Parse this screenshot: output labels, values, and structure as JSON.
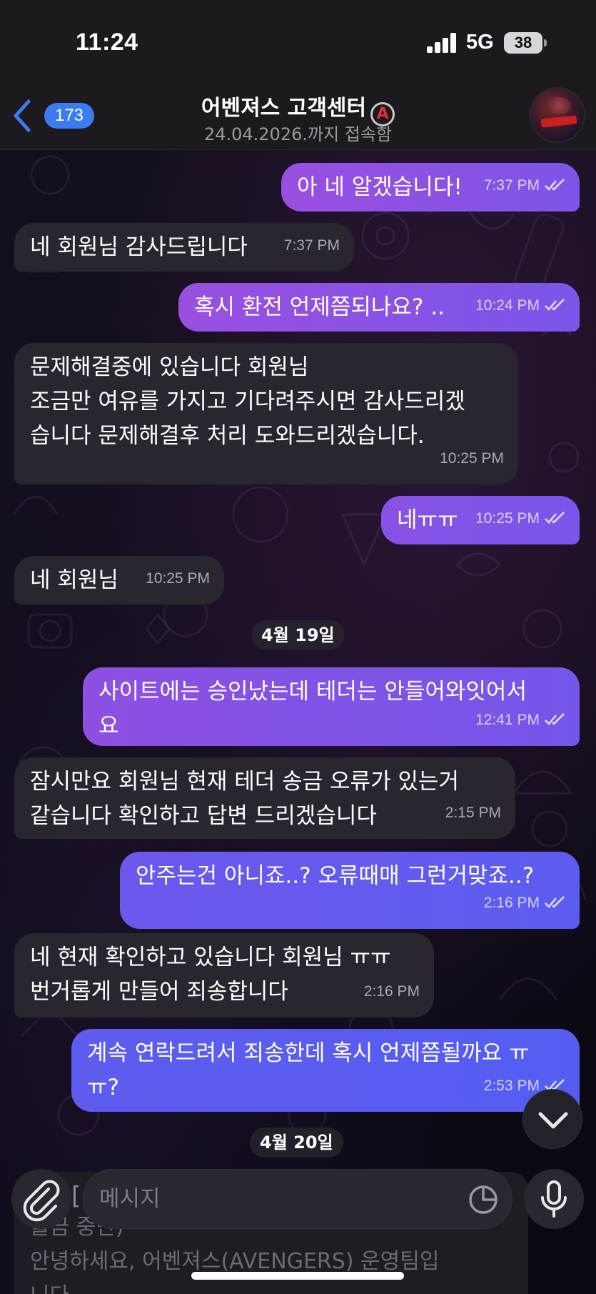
{
  "status_bar": {
    "time": "11:24",
    "network": "5G",
    "battery": "38"
  },
  "header": {
    "back_count": "173",
    "title": "어벤져스 고객센터",
    "title_icon": "avengers-logo-icon",
    "subtitle": "24.04.2026.까지 접속함",
    "avatar": "channel-avatar"
  },
  "messages": [
    {
      "dir": "out",
      "text": "아 네 알겠습니다!",
      "time": "7:37 PM",
      "read": true
    },
    {
      "dir": "in",
      "text": "네 회원님 감사드립니다",
      "time": "7:37 PM"
    },
    {
      "dir": "out",
      "text": "혹시 환전 언제쯤되나요? ..",
      "time": "10:24 PM",
      "read": true
    },
    {
      "dir": "in",
      "text": "문제해결중에 있습니다 회원님\n조금만 여유를 가지고 기다려주시면 감사드리겠\n습니다 문제해결후 처리 도와드리겠습니다.",
      "time": "10:25 PM"
    },
    {
      "dir": "out",
      "text": "네ㅠㅠ",
      "time": "10:25 PM",
      "read": true
    },
    {
      "dir": "in",
      "text": "네 회원님",
      "time": "10:25 PM"
    },
    {
      "dir": "out",
      "text": "사이트에는 승인났는데 테더는 안들어와잇어서\n요",
      "time": "12:41 PM",
      "read": true
    },
    {
      "dir": "in",
      "text": "잠시만요 회원님 현재 테더 송금 오류가 있는거\n같습니다 확인하고 답변 드리겠습니다",
      "time": "2:15 PM"
    },
    {
      "dir": "out",
      "text": "안주는건 아니죠..? 오류때매 그런거맞죠..?",
      "time": "2:16 PM",
      "read": true
    },
    {
      "dir": "in",
      "text": "네 현재 확인하고 있습니다 회원님 ㅠㅠ\n번거롭게 만들어 죄송합니다",
      "time": "2:16 PM"
    },
    {
      "dir": "out",
      "text": "계속 연락드려서 죄송한데 혹시 언제쯤될까요 ㅠ\nㅠ?",
      "time": "2:53 PM",
      "read": true
    }
  ],
  "date_dividers": [
    "4월 19일",
    "4월 20일"
  ],
  "preview": {
    "line1_fragment": "[",
    "line2": "출금 중단)",
    "line3": "안녕하세요, 어벤져스(AVENGERS) 운영팀입",
    "line4": "니다"
  },
  "composer": {
    "placeholder": "메시지"
  },
  "colors": {
    "outgoing_top": "#9b4fe0",
    "outgoing_bottom": "#5a5cf0",
    "incoming": "#2a2630",
    "accent": "#3b7df0"
  }
}
